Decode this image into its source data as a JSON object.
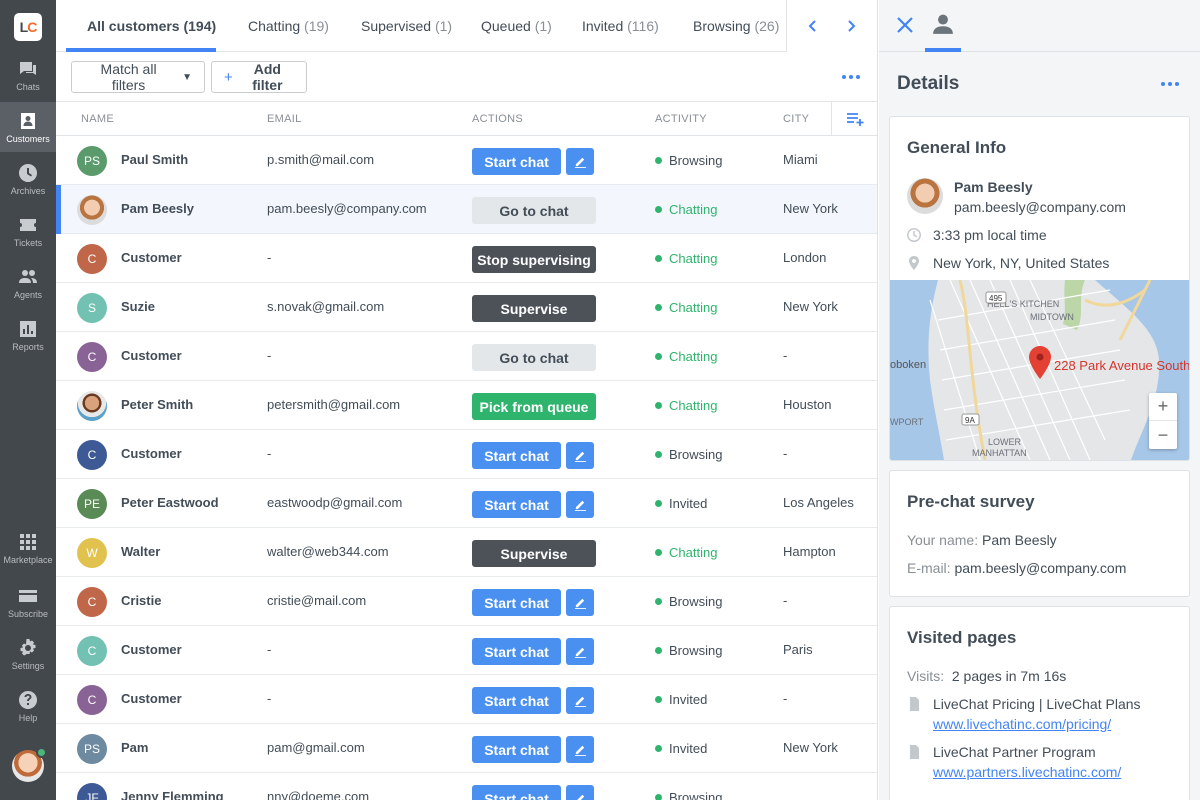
{
  "nav": {
    "logo": {
      "l": "L",
      "c": "C"
    },
    "items": [
      {
        "label": "Chats",
        "icon": "chats-icon"
      },
      {
        "label": "Customers",
        "icon": "customers-icon"
      },
      {
        "label": "Archives",
        "icon": "archives-icon"
      },
      {
        "label": "Tickets",
        "icon": "tickets-icon"
      },
      {
        "label": "Agents",
        "icon": "agents-icon"
      },
      {
        "label": "Reports",
        "icon": "reports-icon"
      },
      {
        "label": "Marketplace",
        "icon": "marketplace-icon"
      },
      {
        "label": "Subscribe",
        "icon": "subscribe-icon"
      },
      {
        "label": "Settings",
        "icon": "settings-icon"
      },
      {
        "label": "Help",
        "icon": "help-icon"
      }
    ]
  },
  "tabs": [
    {
      "label": "All customers",
      "count": "(194)"
    },
    {
      "label": "Chatting",
      "count": "(19)"
    },
    {
      "label": "Supervised",
      "count": "(1)"
    },
    {
      "label": "Queued",
      "count": "(1)"
    },
    {
      "label": "Invited",
      "count": "(116)"
    },
    {
      "label": "Browsing",
      "count": "(26)"
    }
  ],
  "filters": {
    "match": "Match all filters",
    "add": "Add filter"
  },
  "columns": {
    "name": "NAME",
    "email": "EMAIL",
    "actions": "ACTIONS",
    "activity": "ACTIVITY",
    "city": "CITY"
  },
  "customers": [
    {
      "initials": "PS",
      "color": "#5a9a6b",
      "name": "Paul Smith",
      "email": "p.smith@mail.com",
      "action": "Start chat",
      "style": "blue",
      "status": "Browsing",
      "city": "Miami"
    },
    {
      "initials": "",
      "photo": 1,
      "name": "Pam Beesly",
      "email": "pam.beesly@company.com",
      "action": "Go to chat",
      "style": "gray",
      "status": "Chatting",
      "city": "New York"
    },
    {
      "initials": "C",
      "color": "#c0674a",
      "name": "Customer",
      "email": "-",
      "action": "Stop supervising",
      "style": "dark",
      "status": "Chatting",
      "city": "London"
    },
    {
      "initials": "S",
      "color": "#72c1b2",
      "name": "Suzie",
      "email": "s.novak@gmail.com",
      "action": "Supervise",
      "style": "dark",
      "status": "Chatting",
      "city": "New York"
    },
    {
      "initials": "C",
      "color": "#8a6396",
      "name": "Customer",
      "email": "-",
      "action": "Go to chat",
      "style": "gray",
      "status": "Chatting",
      "city": "-"
    },
    {
      "initials": "",
      "photo": 2,
      "name": "Peter Smith",
      "email": "petersmith@gmail.com",
      "action": "Pick from queue",
      "style": "green",
      "status": "Chatting",
      "city": "Houston"
    },
    {
      "initials": "C",
      "color": "#3e5a96",
      "name": "Customer",
      "email": "-",
      "action": "Start chat",
      "style": "blue",
      "status": "Browsing",
      "city": "-"
    },
    {
      "initials": "PE",
      "color": "#5a8a55",
      "name": "Peter Eastwood",
      "email": "eastwoodp@gmail.com",
      "action": "Start chat",
      "style": "blue",
      "status": "Invited",
      "city": "Los Angeles"
    },
    {
      "initials": "W",
      "color": "#e2c24f",
      "name": "Walter",
      "email": "walter@web344.com",
      "action": "Supervise",
      "style": "dark",
      "status": "Chatting",
      "city": "Hampton"
    },
    {
      "initials": "C",
      "color": "#c0674a",
      "name": "Cristie",
      "email": "cristie@mail.com",
      "action": "Start chat",
      "style": "blue",
      "status": "Browsing",
      "city": "-"
    },
    {
      "initials": "C",
      "color": "#72c1b2",
      "name": "Customer",
      "email": "-",
      "action": "Start chat",
      "style": "blue",
      "status": "Browsing",
      "city": "Paris"
    },
    {
      "initials": "C",
      "color": "#8a6396",
      "name": "Customer",
      "email": "-",
      "action": "Start chat",
      "style": "blue",
      "status": "Invited",
      "city": "-"
    },
    {
      "initials": "PS",
      "color": "#6d8aa0",
      "name": "Pam",
      "email": "pam@gmail.com",
      "action": "Start chat",
      "style": "blue",
      "status": "Invited",
      "city": "New York"
    },
    {
      "initials": "JF",
      "color": "#3e5a96",
      "name": "Jenny Flemming",
      "email": "nny@doeme.com",
      "action": "Start chat",
      "style": "blue",
      "status": "Browsing",
      "city": ""
    }
  ],
  "details": {
    "title": "Details",
    "general": {
      "heading": "General Info",
      "name": "Pam Beesly",
      "email": "pam.beesly@company.com",
      "local_time": "3:33 pm local time",
      "location": "New York, NY, United States",
      "map": {
        "pin_label": "228 Park Avenue South",
        "labels": [
          "HELL'S KITCHEN",
          "MIDTOWN",
          "oboken",
          "WPORT",
          "LOWER",
          "MANHATTAN",
          "495",
          "9A"
        ],
        "zoom_in": "+",
        "zoom_out": "−"
      }
    },
    "survey": {
      "heading": "Pre-chat survey",
      "name_label": "Your name:",
      "name_value": "Pam Beesly",
      "email_label": "E-mail:",
      "email_value": "pam.beesly@company.com"
    },
    "visited": {
      "heading": "Visited pages",
      "visits_label": "Visits:",
      "visits_value": "2 pages in 7m 16s",
      "pages": [
        {
          "title": "LiveChat Pricing | LiveChat Plans",
          "url": "www.livechatinc.com/pricing/"
        },
        {
          "title": "LiveChat Partner Program",
          "url": "www.partners.livechatinc.com/"
        }
      ]
    }
  }
}
